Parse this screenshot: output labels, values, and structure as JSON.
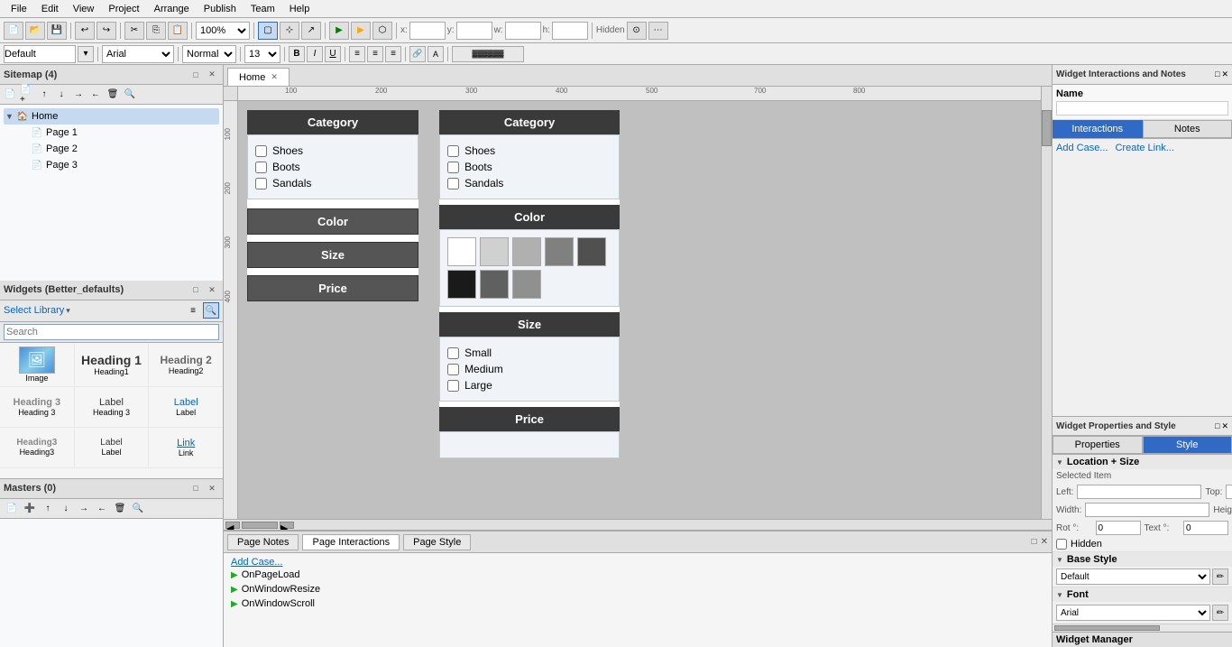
{
  "menu": {
    "items": [
      "File",
      "Edit",
      "View",
      "Project",
      "Arrange",
      "Publish",
      "Team",
      "Help"
    ]
  },
  "toolbar": {
    "zoom": "100%",
    "font_family": "Arial",
    "font_style": "Normal",
    "font_size": "13"
  },
  "sitemap": {
    "title": "Sitemap (4)",
    "items": [
      {
        "label": "Home",
        "type": "folder",
        "expanded": true
      },
      {
        "label": "Page 1",
        "type": "page"
      },
      {
        "label": "Page 2",
        "type": "page"
      },
      {
        "label": "Page 3",
        "type": "page"
      }
    ]
  },
  "widgets": {
    "title": "Widgets (Better_defaults)",
    "library_label": "Select Library",
    "search_placeholder": "Search",
    "items": [
      {
        "label": "Image",
        "type": "image"
      },
      {
        "label": "Heading1",
        "type": "h1"
      },
      {
        "label": "Heading2",
        "type": "h2"
      },
      {
        "label": "Heading 1",
        "type": "h1-row"
      },
      {
        "label": "Heading 2",
        "type": "h2-row"
      },
      {
        "label": "Heading 3",
        "type": "h3"
      },
      {
        "label": "Label",
        "type": "label"
      },
      {
        "label": "Label",
        "type": "label-blue"
      },
      {
        "label": "Heading3",
        "type": "h3-row"
      },
      {
        "label": "Label",
        "type": "label2"
      },
      {
        "label": "Link",
        "type": "link"
      }
    ]
  },
  "masters": {
    "title": "Masters (0)"
  },
  "canvas": {
    "tab_label": "Home",
    "left_category_title": "Category",
    "left_category_items": [
      "Shoes",
      "Boots",
      "Sandals"
    ],
    "left_color_label": "Color",
    "left_size_label": "Size",
    "left_price_label": "Price",
    "right_category_title": "Category",
    "right_category_items": [
      "Shoes",
      "Boots",
      "Sandals"
    ],
    "right_color_title": "Color",
    "right_size_title": "Size",
    "right_size_items": [
      "Small",
      "Medium",
      "Large"
    ],
    "right_price_title": "Price",
    "color_swatches": [
      "#ffffff",
      "#d0d0d0",
      "#b0b0b0",
      "#888888",
      "#505050",
      "#1a1a1a",
      "#606060",
      "#909090"
    ]
  },
  "selected_widget": {
    "name_label": "Name"
  },
  "interactions_panel": {
    "title": "Widget Interactions and Notes",
    "name_label": "Name",
    "interactions_tab": "Interactions",
    "notes_tab": "Notes",
    "add_case_link": "Add Case...",
    "create_link_link": "Create Link..."
  },
  "properties_panel": {
    "title": "Widget Properties and Style",
    "properties_tab": "Properties",
    "style_tab": "Style",
    "location_size_label": "Location + Size",
    "selected_item_label": "Selected Item",
    "left_label": "Left:",
    "top_label": "Top:",
    "width_label": "Width:",
    "height_label": "Height:",
    "rot_label": "Rot °:",
    "rot_value": "0",
    "text_label": "Text °:",
    "text_value": "0",
    "hidden_label": "Hidden",
    "base_style_label": "Base Style",
    "base_style_value": "Default",
    "font_label": "Font"
  },
  "bottom_panel": {
    "page_notes_tab": "Page Notes",
    "page_interactions_tab": "Page Interactions",
    "page_style_tab": "Page Style",
    "add_case_link": "Add Case...",
    "interactions": [
      {
        "event": "OnPageLoad"
      },
      {
        "event": "OnWindowResize"
      },
      {
        "event": "OnWindowScroll"
      }
    ]
  }
}
